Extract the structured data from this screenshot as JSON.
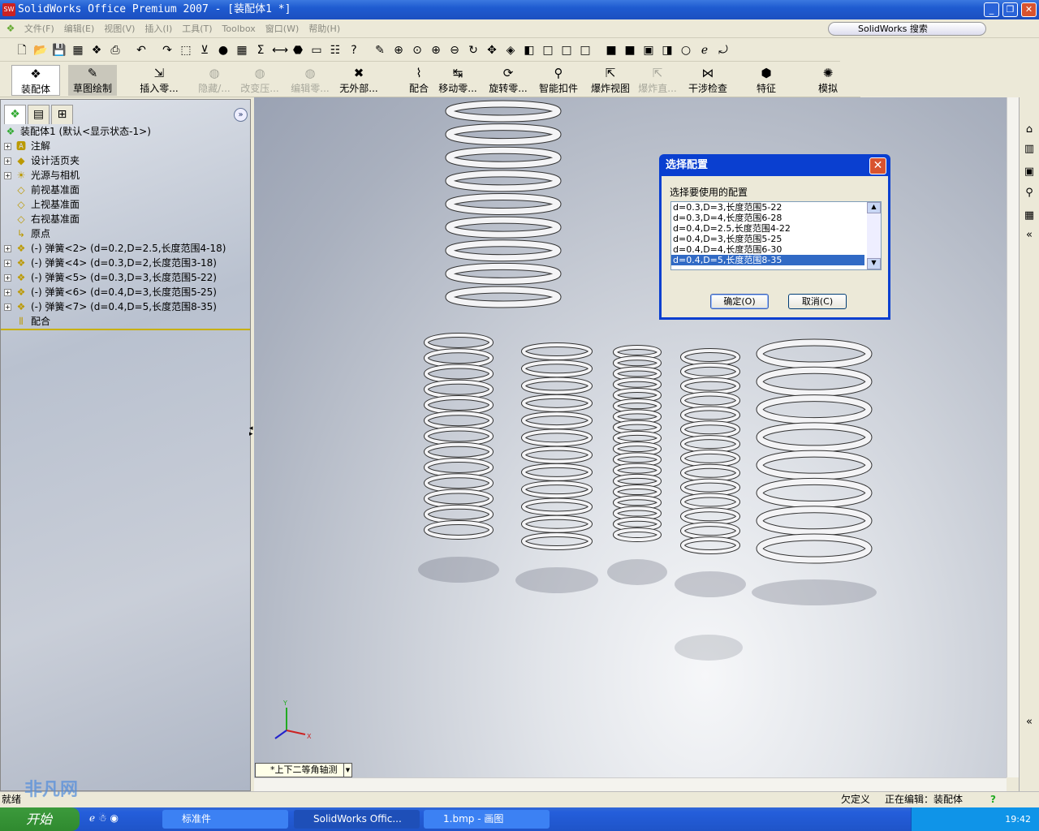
{
  "window": {
    "title": "SolidWorks Office Premium 2007 - [装配体1 *]",
    "logo": "SW"
  },
  "menu": [
    "文件(F)",
    "编辑(E)",
    "视图(V)",
    "插入(I)",
    "工具(T)",
    "Toolbox",
    "窗口(W)",
    "帮助(H)"
  ],
  "search": {
    "label": "SolidWorks 搜索"
  },
  "command_manager": [
    {
      "label": "装配体",
      "disabled": false,
      "icon": "assembly-icon"
    },
    {
      "label": "草图绘制",
      "disabled": false,
      "icon": "sketch-icon"
    },
    {
      "label": "插入零...",
      "disabled": false,
      "icon": "insert-component-icon"
    },
    {
      "label": "隐藏/...",
      "disabled": true,
      "icon": "hide-show-icon"
    },
    {
      "label": "改变压...",
      "disabled": true,
      "icon": "change-suppression-icon"
    },
    {
      "label": "编辑零...",
      "disabled": true,
      "icon": "edit-component-icon"
    },
    {
      "label": "无外部...",
      "disabled": false,
      "icon": "no-external-refs-icon"
    },
    {
      "label": "配合",
      "disabled": false,
      "icon": "mate-icon"
    },
    {
      "label": "移动零...",
      "disabled": false,
      "icon": "move-component-icon"
    },
    {
      "label": "旋转零...",
      "disabled": false,
      "icon": "rotate-component-icon"
    },
    {
      "label": "智能扣件",
      "disabled": false,
      "icon": "smart-fasteners-icon"
    },
    {
      "label": "爆炸视图",
      "disabled": false,
      "icon": "exploded-view-icon"
    },
    {
      "label": "爆炸直...",
      "disabled": true,
      "icon": "explode-line-icon"
    },
    {
      "label": "干涉检查",
      "disabled": false,
      "icon": "interference-icon"
    },
    {
      "label": "特征",
      "disabled": false,
      "icon": "features-icon"
    },
    {
      "label": "模拟",
      "disabled": false,
      "icon": "simulation-icon"
    }
  ],
  "tree": {
    "root": "装配体1  (默认<显示状态-1>)",
    "items": [
      {
        "label": "注解",
        "expand": true,
        "icon": "annotations-icon"
      },
      {
        "label": "设计活页夹",
        "expand": true,
        "icon": "design-binder-icon"
      },
      {
        "label": "光源与相机",
        "expand": true,
        "icon": "lights-cameras-icon"
      },
      {
        "label": "前视基准面",
        "expand": false,
        "icon": "plane-icon"
      },
      {
        "label": "上视基准面",
        "expand": false,
        "icon": "plane-icon"
      },
      {
        "label": "右视基准面",
        "expand": false,
        "icon": "plane-icon"
      },
      {
        "label": "原点",
        "expand": false,
        "icon": "origin-icon"
      },
      {
        "label": "(-) 弹簧<2> (d=0.2,D=2.5,长度范围4-18)",
        "expand": true,
        "icon": "part-icon"
      },
      {
        "label": "(-) 弹簧<4> (d=0.3,D=2,长度范围3-18)",
        "expand": true,
        "icon": "part-icon"
      },
      {
        "label": "(-) 弹簧<5> (d=0.3,D=3,长度范围5-22)",
        "expand": true,
        "icon": "part-icon"
      },
      {
        "label": "(-) 弹簧<6> (d=0.4,D=3,长度范围5-25)",
        "expand": true,
        "icon": "part-icon"
      },
      {
        "label": "(-) 弹簧<7> (d=0.4,D=5,长度范围8-35)",
        "expand": true,
        "icon": "part-icon"
      },
      {
        "label": "配合",
        "expand": false,
        "icon": "mates-icon"
      }
    ]
  },
  "viewport": {
    "view_orientation": "*上下二等角轴测",
    "axes": {
      "x": "X",
      "y": "Y"
    }
  },
  "dialog": {
    "title": "选择配置",
    "prompt": "选择要使用的配置",
    "options": [
      "d=0.3,D=3,长度范围5-22",
      "d=0.3,D=4,长度范围6-28",
      "d=0.4,D=2.5,长度范围4-22",
      "d=0.4,D=3,长度范围5-25",
      "d=0.4,D=4,长度范围6-30",
      "d=0.4,D=5,长度范围8-35"
    ],
    "selected": "d=0.4,D=5,长度范围8-35",
    "ok": "确定(O)",
    "cancel": "取消(C)"
  },
  "status": {
    "left": "就绪",
    "state": "欠定义",
    "editing": "正在编辑：装配体"
  },
  "taskbar": {
    "start": "开始",
    "tasks": [
      "标准件",
      "SolidWorks Offic...",
      "1.bmp - 画图"
    ],
    "clock": "19:42"
  },
  "watermark": "非凡网 cn"
}
